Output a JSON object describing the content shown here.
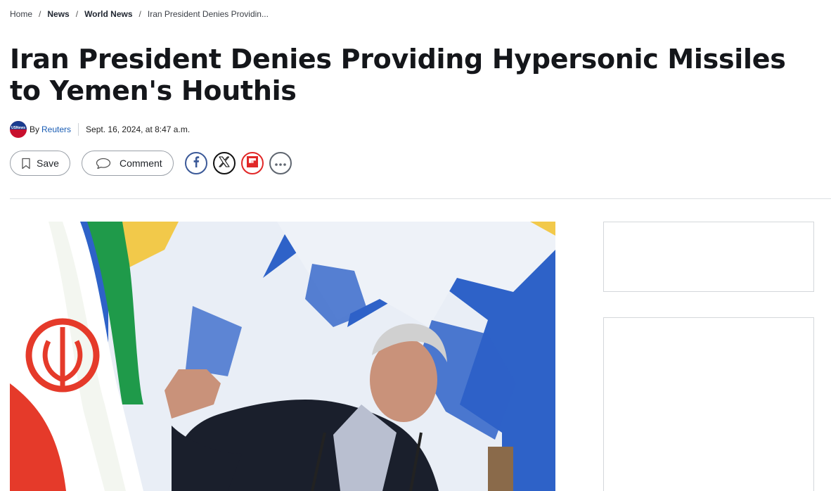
{
  "breadcrumb": {
    "home": "Home",
    "news": "News",
    "world_news": "World News",
    "current": "Iran President Denies Providin..."
  },
  "article": {
    "title": "Iran President Denies Providing Hypersonic Missiles to Yemen's Houthis",
    "byline_prefix": "By",
    "author": "Reuters",
    "date": "Sept. 16, 2024, at 8:47 a.m.",
    "logo_text": "USNews"
  },
  "actions": {
    "save_label": "Save",
    "comment_label": "Comment"
  },
  "icons": {
    "save": "bookmark-icon",
    "comment": "speech-bubble-icon",
    "facebook": "facebook-icon",
    "x": "x-icon",
    "flipboard": "flipboard-icon",
    "more": "more-icon"
  },
  "colors": {
    "author_link": "#1a5db4",
    "facebook": "#3b5998",
    "flipboard": "#e12828"
  }
}
